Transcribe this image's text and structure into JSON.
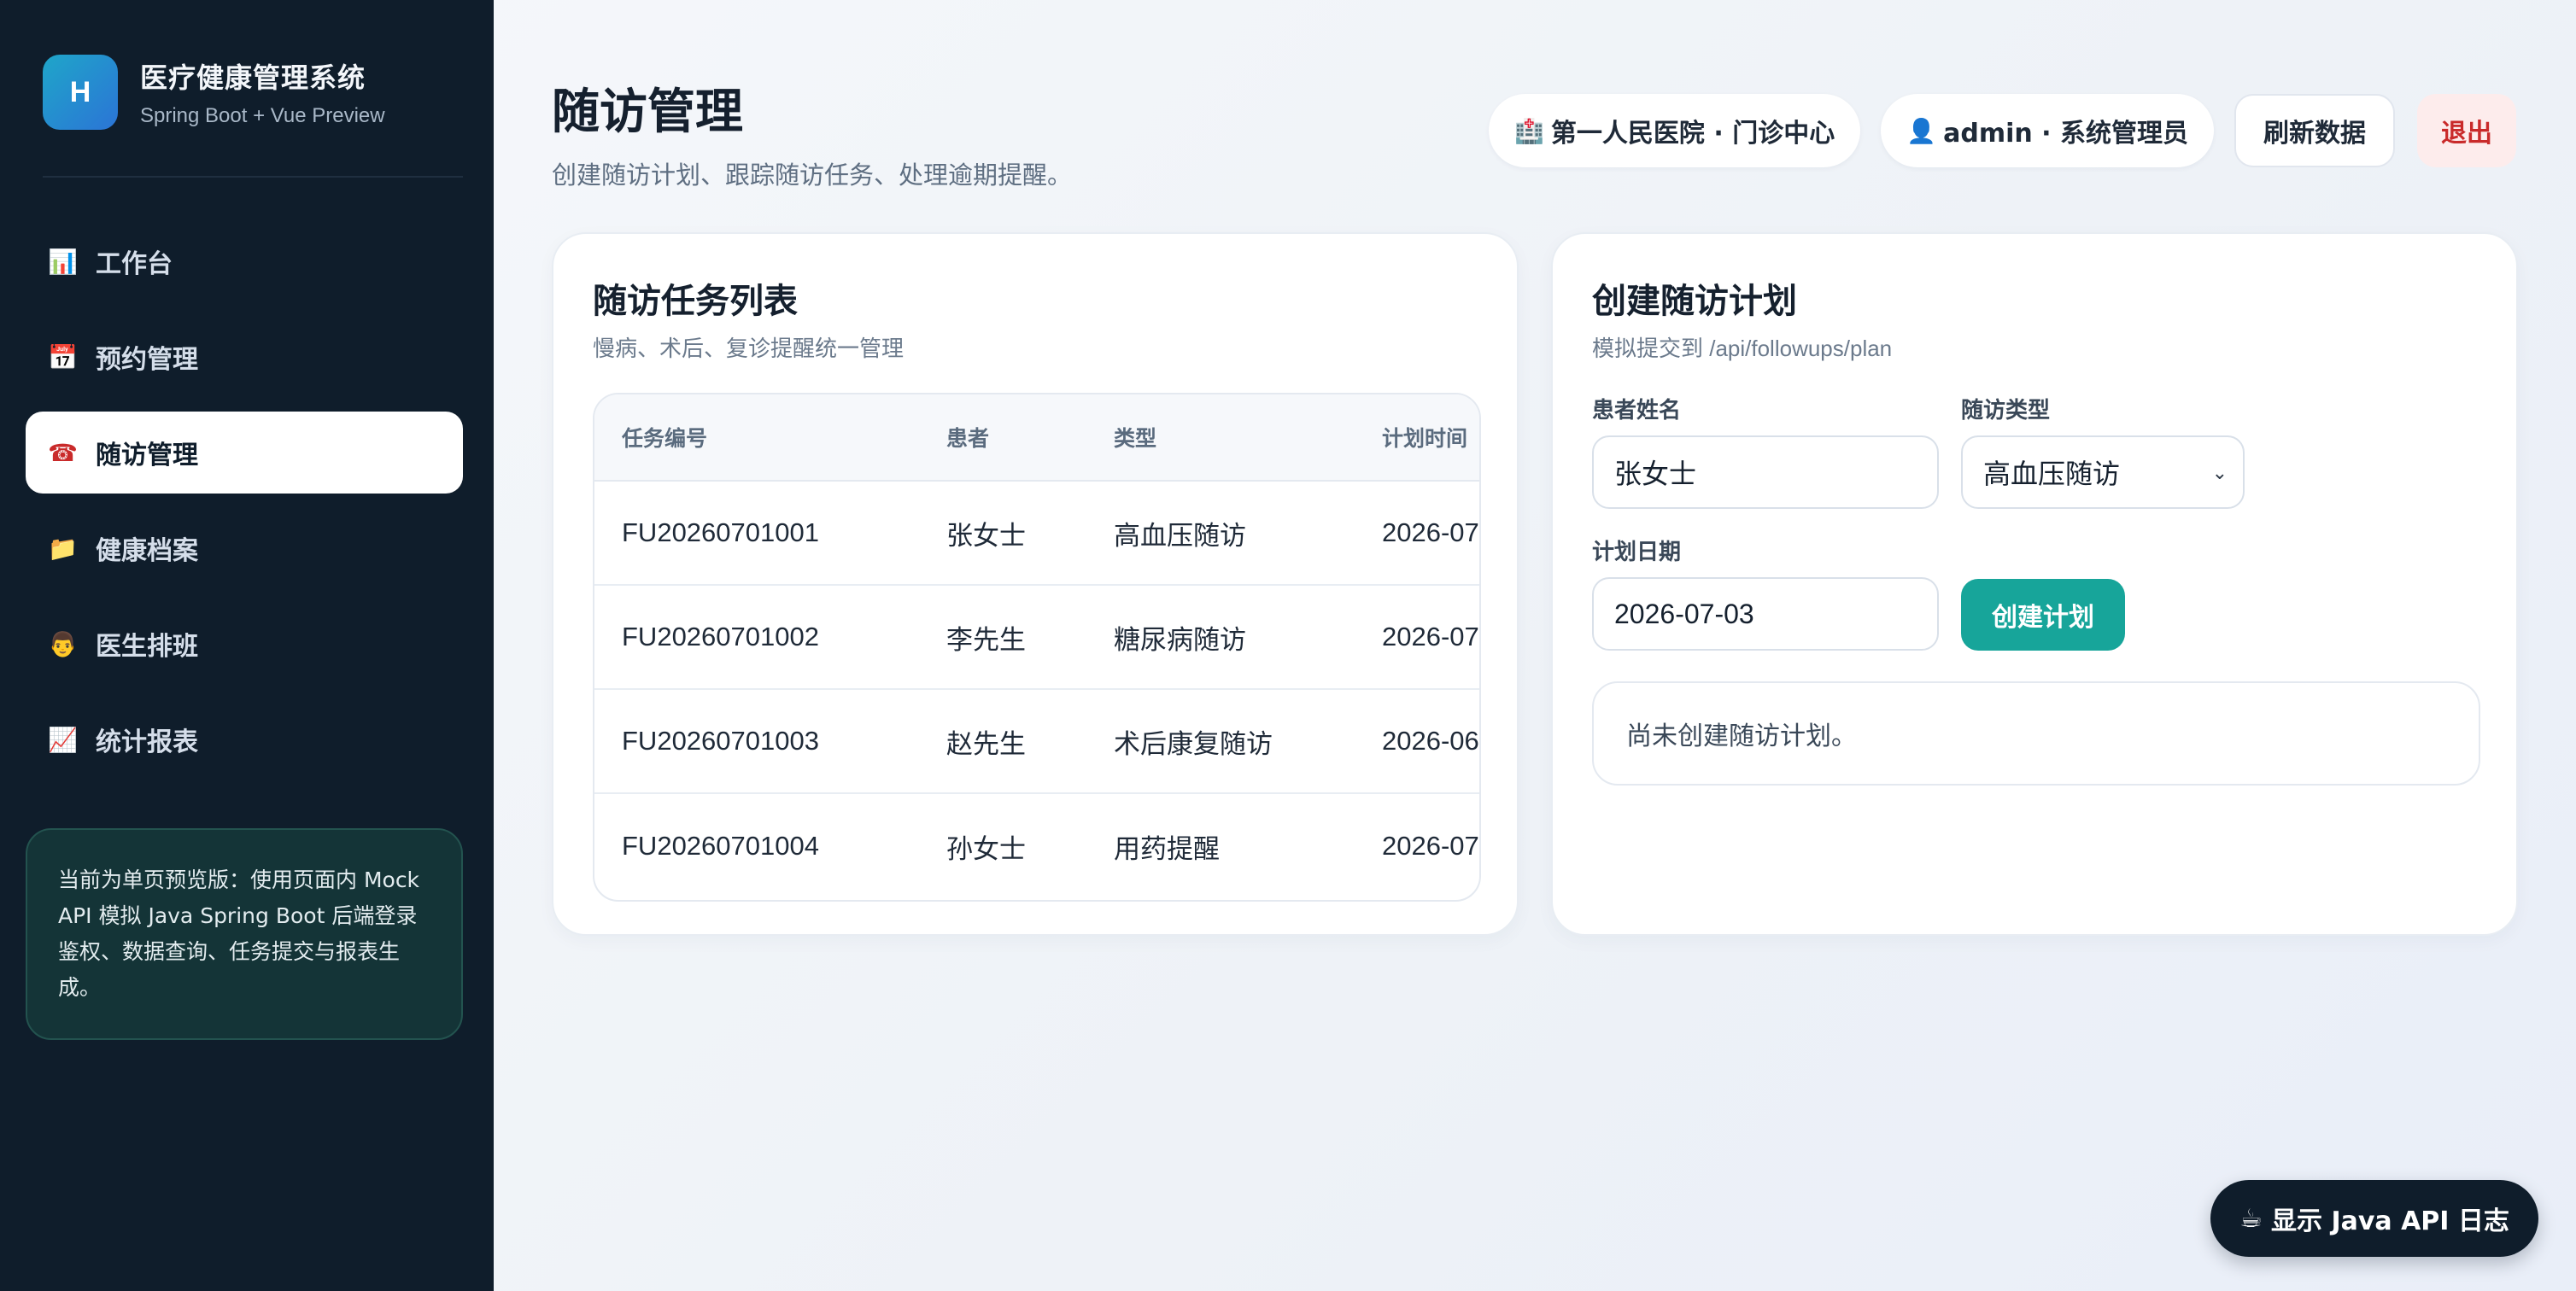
{
  "brand": {
    "logo_letter": "H",
    "title": "医疗健康管理系统",
    "subtitle": "Spring Boot + Vue Preview"
  },
  "nav": [
    {
      "icon": "📊",
      "icon_name": "chart-icon",
      "label": "工作台"
    },
    {
      "icon": "📅",
      "icon_name": "calendar-icon",
      "label": "预约管理"
    },
    {
      "icon": "☎",
      "icon_name": "phone-icon",
      "label": "随访管理",
      "active": true
    },
    {
      "icon": "📁",
      "icon_name": "folder-icon",
      "label": "健康档案"
    },
    {
      "icon": "👨",
      "icon_name": "doctor-icon",
      "label": "医生排班"
    },
    {
      "icon": "📈",
      "icon_name": "trend-icon",
      "label": "统计报表"
    }
  ],
  "notice": "当前为单页预览版：使用页面内 Mock API 模拟 Java Spring Boot 后端登录鉴权、数据查询、任务提交与报表生成。",
  "header": {
    "title": "随访管理",
    "subtitle": "创建随访计划、跟踪随访任务、处理逾期提醒。",
    "hospital_icon": "🏥",
    "hospital": "第一人民医院 · 门诊中心",
    "user_icon": "👤",
    "user": "admin · 系统管理员",
    "refresh_label": "刷新数据",
    "logout_label": "退出"
  },
  "task_list": {
    "title": "随访任务列表",
    "subtitle": "慢病、术后、复诊提醒统一管理",
    "columns": [
      "任务编号",
      "患者",
      "类型",
      "计划时间"
    ],
    "rows": [
      {
        "id": "FU20260701001",
        "patient": "张女士",
        "type": "高血压随访",
        "date": "2026-07"
      },
      {
        "id": "FU20260701002",
        "patient": "李先生",
        "type": "糖尿病随访",
        "date": "2026-07"
      },
      {
        "id": "FU20260701003",
        "patient": "赵先生",
        "type": "术后康复随访",
        "date": "2026-06"
      },
      {
        "id": "FU20260701004",
        "patient": "孙女士",
        "type": "用药提醒",
        "date": "2026-07"
      }
    ]
  },
  "plan_form": {
    "title": "创建随访计划",
    "subtitle": "模拟提交到 /api/followups/plan",
    "patient_label": "患者姓名",
    "patient_value": "张女士",
    "type_label": "随访类型",
    "type_value": "高血压随访",
    "date_label": "计划日期",
    "date_value": "2026-07-03",
    "create_label": "创建计划",
    "result": "尚未创建随访计划。"
  },
  "log_button": {
    "icon": "☕",
    "label": "显示 Java API 日志"
  }
}
